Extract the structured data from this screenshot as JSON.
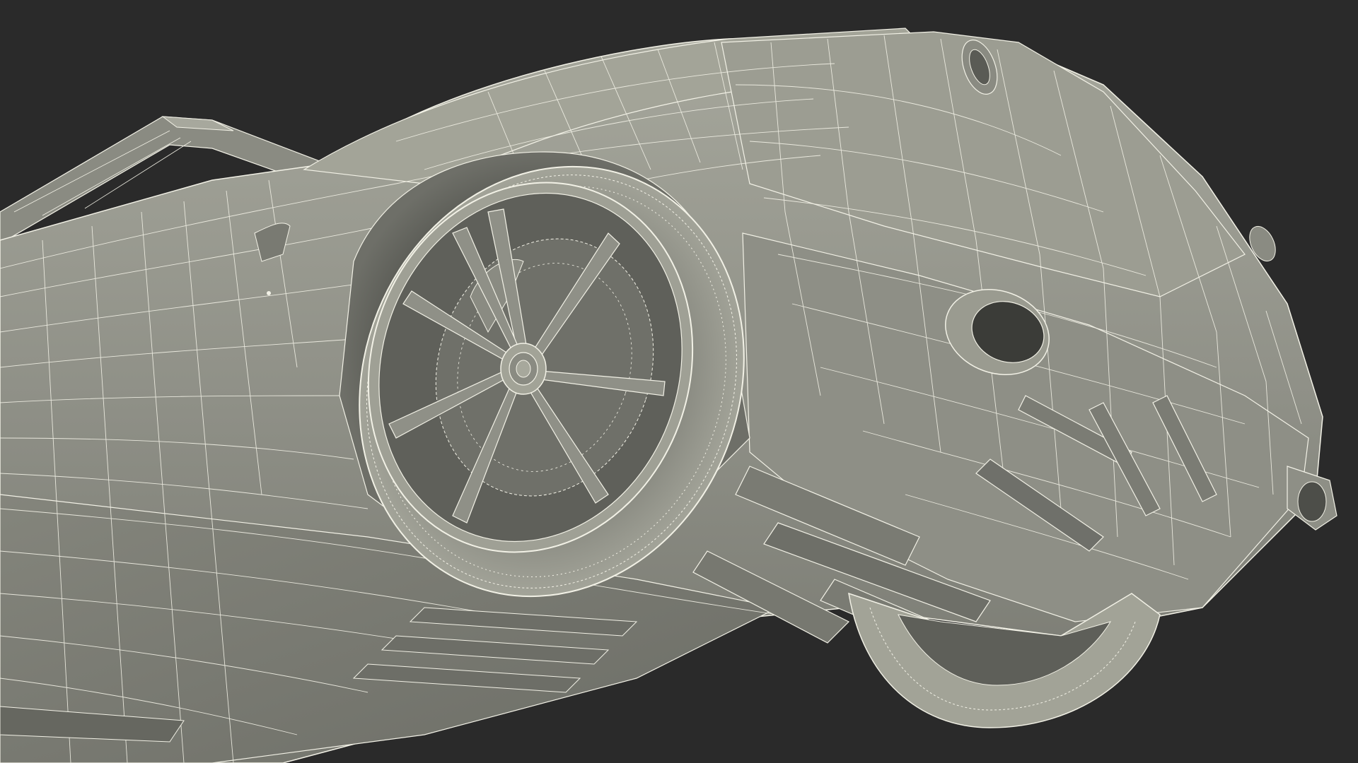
{
  "scene": {
    "subject": "wireframe-car-underside",
    "colors": {
      "background": "#2a2a2a",
      "surface": "#8d8e85",
      "surface_light": "#a9aa9f",
      "surface_dark": "#5d5e57",
      "shadow": "#3e3f3b",
      "wire": "#f2f1e6"
    }
  }
}
